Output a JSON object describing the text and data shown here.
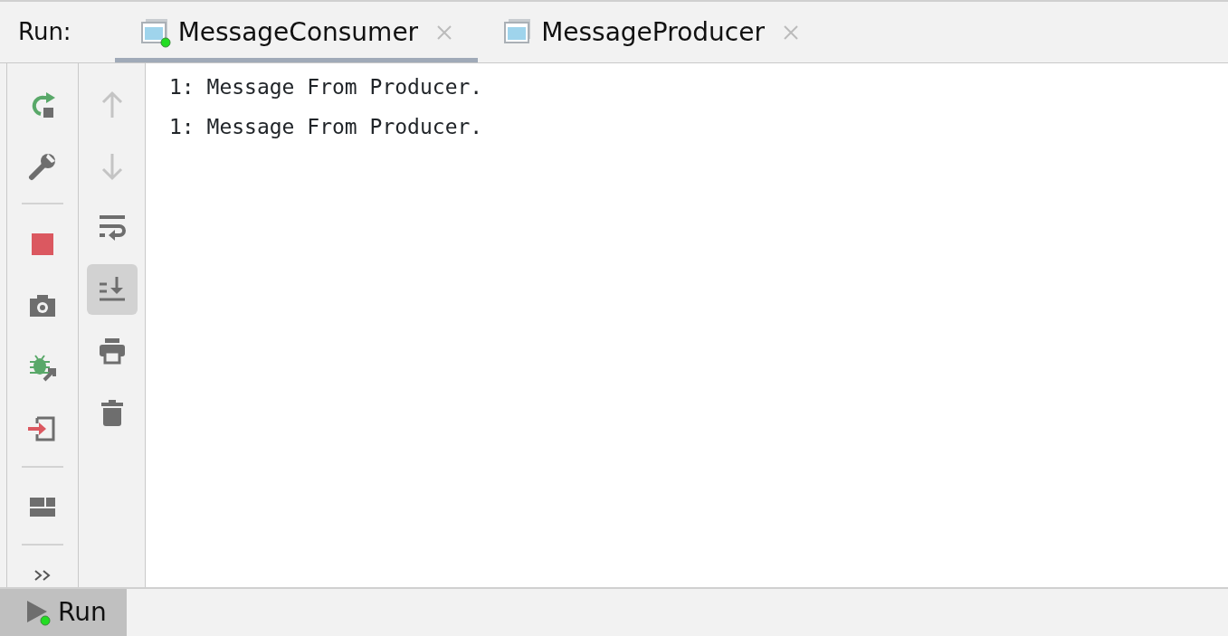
{
  "run_label": "Run:",
  "tabs": [
    {
      "label": "MessageConsumer",
      "selected": true,
      "running": true
    },
    {
      "label": "MessageProducer",
      "selected": false,
      "running": false
    }
  ],
  "main_toolbar": [
    {
      "kind": "rerun"
    },
    {
      "kind": "settings"
    },
    {
      "kind": "separator"
    },
    {
      "kind": "stop"
    },
    {
      "kind": "snapshot"
    },
    {
      "kind": "debug-attach"
    },
    {
      "kind": "login"
    },
    {
      "kind": "separator"
    },
    {
      "kind": "layout"
    },
    {
      "kind": "separator"
    },
    {
      "kind": "more"
    }
  ],
  "console_toolbar": [
    {
      "kind": "up",
      "disabled": true,
      "selected": false
    },
    {
      "kind": "down",
      "disabled": true,
      "selected": false
    },
    {
      "kind": "wrap",
      "disabled": false,
      "selected": false
    },
    {
      "kind": "scroll-end",
      "disabled": false,
      "selected": true
    },
    {
      "kind": "print",
      "disabled": false,
      "selected": false
    },
    {
      "kind": "trash",
      "disabled": false,
      "selected": false
    }
  ],
  "console_lines": [
    "1: Message From Producer.",
    "1: Message From Producer."
  ],
  "bottom_tabs": [
    {
      "label": "Run",
      "selected": true,
      "running": true
    }
  ]
}
